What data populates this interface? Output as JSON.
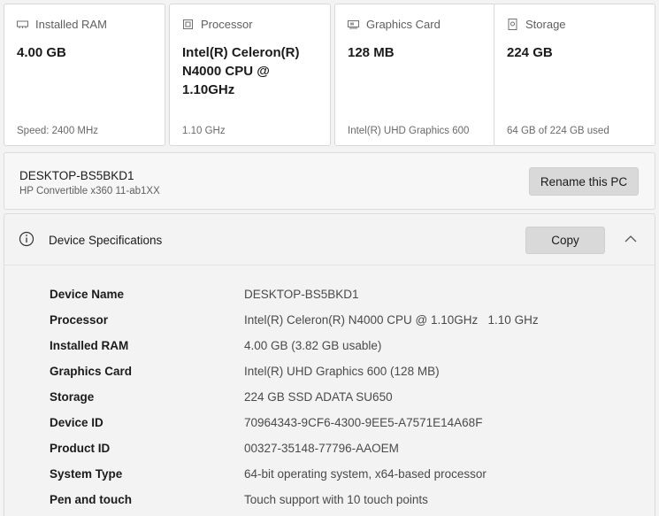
{
  "cards": [
    {
      "icon": "ram-icon",
      "label": "Installed RAM",
      "value": "4.00 GB",
      "sub": "Speed: 2400 MHz"
    },
    {
      "icon": "processor-icon",
      "label": "Processor",
      "value": "Intel(R) Celeron(R) N4000 CPU @ 1.10GHz",
      "sub": "1.10 GHz"
    },
    {
      "icon": "graphics-card-icon",
      "label": "Graphics Card",
      "value": "128 MB",
      "sub": "Intel(R) UHD Graphics 600"
    },
    {
      "icon": "storage-icon",
      "label": "Storage",
      "value": "224 GB",
      "sub": "64 GB of 224 GB used"
    }
  ],
  "pc": {
    "name": "DESKTOP-BS5BKD1",
    "model": "HP Convertible x360 11-ab1XX",
    "rename_label": "Rename this PC"
  },
  "spec": {
    "title": "Device Specifications",
    "copy_label": "Copy",
    "expanded": true,
    "rows": [
      {
        "key": "Device Name",
        "value": "DESKTOP-BS5BKD1"
      },
      {
        "key": "Processor",
        "value": "Intel(R) Celeron(R) N4000 CPU @ 1.10GHz   1.10 GHz"
      },
      {
        "key": "Installed RAM",
        "value": "4.00 GB (3.82 GB usable)"
      },
      {
        "key": "Graphics Card",
        "value": "Intel(R) UHD Graphics 600 (128 MB)"
      },
      {
        "key": "Storage",
        "value": "224 GB SSD ADATA SU650"
      },
      {
        "key": "Device ID",
        "value": "70964343-9CF6-4300-9EE5-A7571E14A68F"
      },
      {
        "key": "Product ID",
        "value": "00327-35148-77796-AAOEM"
      },
      {
        "key": "System Type",
        "value": "64-bit operating system, x64-based processor"
      },
      {
        "key": "Pen and touch",
        "value": "Touch support with 10 touch points"
      }
    ]
  }
}
